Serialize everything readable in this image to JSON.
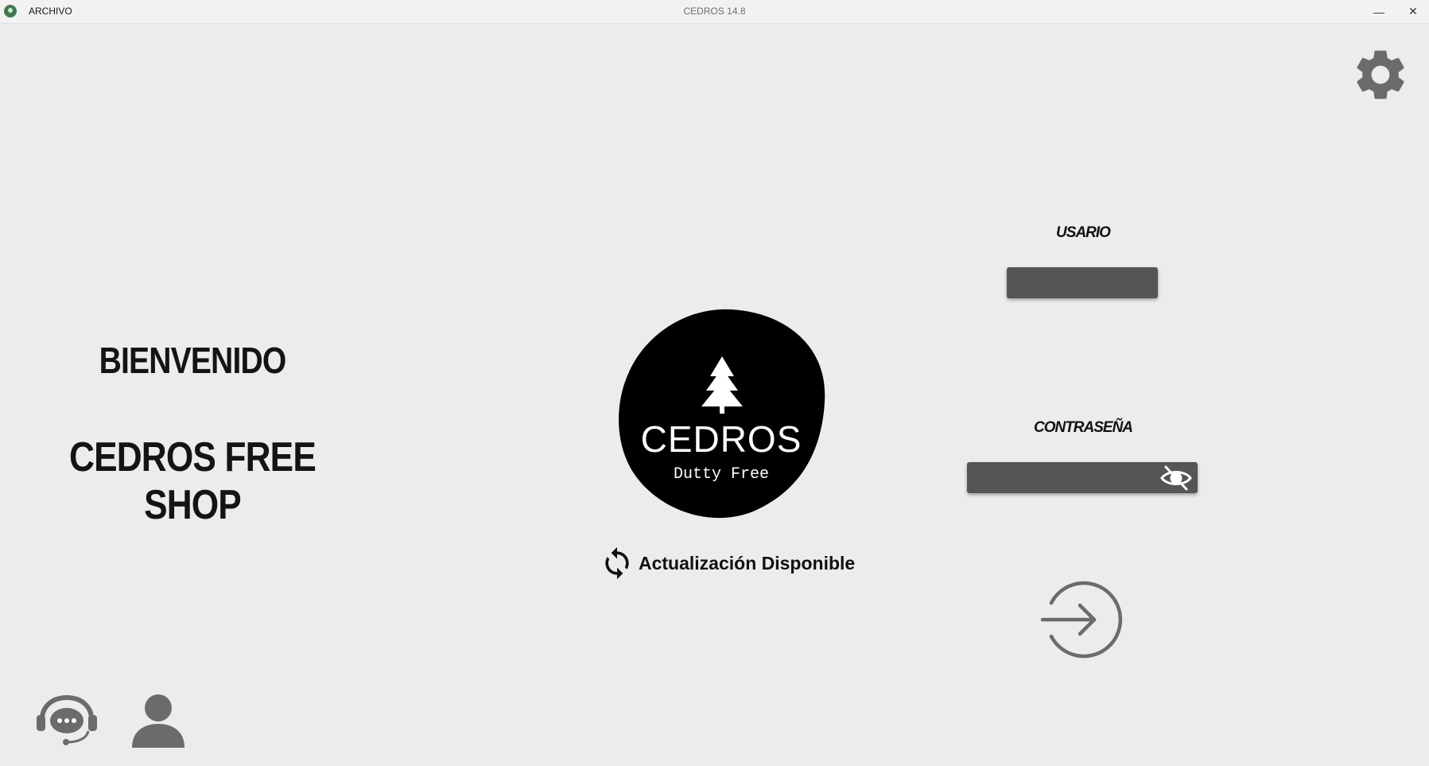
{
  "titlebar": {
    "menu_archivo": "ARCHIVO",
    "title": "CEDROS 14.8",
    "minimize_glyph": "—",
    "close_glyph": "✕"
  },
  "welcome": {
    "greeting": "BIENVENIDO",
    "shop_name": "CEDROS FREE SHOP"
  },
  "logo": {
    "name": "CEDROS",
    "subtitle": "Dutty Free"
  },
  "update": {
    "text": "Actualización Disponible",
    "icon": "refresh-icon"
  },
  "login_form": {
    "user_label": "USARIO",
    "user_value": "",
    "password_label": "CONTRASEÑA",
    "password_value": "",
    "toggle_icon": "eye-slash-icon",
    "submit_icon": "login-arrow-icon"
  },
  "icons": {
    "settings": "gear-icon",
    "support": "support-chat-icon",
    "user": "user-icon"
  },
  "colors": {
    "background": "#ececec",
    "input_fill": "#555555",
    "icon_gray": "#6b6b6b",
    "logo_black": "#000000"
  }
}
